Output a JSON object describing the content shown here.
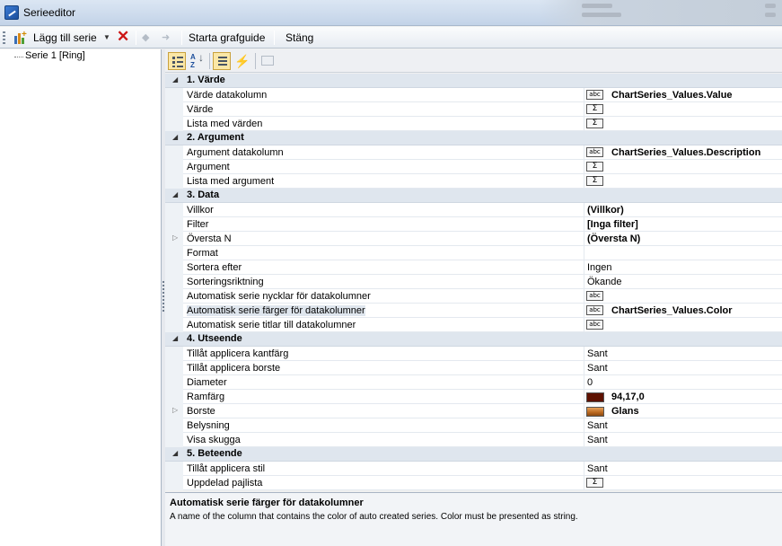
{
  "window": {
    "title": "Serieeditor"
  },
  "toolbar": {
    "add_series": "Lägg till serie",
    "start_wizard": "Starta grafguide",
    "close": "Stäng"
  },
  "tree": {
    "items": [
      "Serie 1 [Ring]"
    ]
  },
  "property_grid": {
    "categories": [
      {
        "label": "1. Värde",
        "rows": [
          {
            "name": "Värde datakolumn",
            "badge": "abc",
            "value": "ChartSeries_Values.Value"
          },
          {
            "name": "Värde",
            "badge": "Σ",
            "value": ""
          },
          {
            "name": "Lista med värden",
            "badge": "Σ",
            "value": ""
          }
        ]
      },
      {
        "label": "2. Argument",
        "rows": [
          {
            "name": "Argument datakolumn",
            "badge": "abc",
            "value": "ChartSeries_Values.Description"
          },
          {
            "name": "Argument",
            "badge": "Σ",
            "value": ""
          },
          {
            "name": "Lista med argument",
            "badge": "Σ",
            "value": ""
          }
        ]
      },
      {
        "label": "3. Data",
        "rows": [
          {
            "name": "Villkor",
            "value": "(Villkor)"
          },
          {
            "name": "Filter",
            "value": "[Inga filter]"
          },
          {
            "name": "Översta N",
            "value": "(Översta N)"
          },
          {
            "name": "Format",
            "value": ""
          },
          {
            "name": "Sortera efter",
            "value": "Ingen"
          },
          {
            "name": "Sorteringsriktning",
            "value": "Ökande"
          },
          {
            "name": "Automatisk serie nycklar för datakolumner",
            "badge": "abc",
            "value": ""
          },
          {
            "name": "Automatisk serie färger för datakolumner",
            "badge": "abc",
            "value": "ChartSeries_Values.Color"
          },
          {
            "name": "Automatisk serie titlar till datakolumner",
            "badge": "abc",
            "value": ""
          }
        ]
      },
      {
        "label": "4. Utseende",
        "rows": [
          {
            "name": "Tillåt applicera kantfärg",
            "value": "Sant"
          },
          {
            "name": "Tillåt applicera borste",
            "value": "Sant"
          },
          {
            "name": "Diameter",
            "value": "0"
          },
          {
            "name": "Ramfärg",
            "value": "94,17,0"
          },
          {
            "name": "Borste",
            "value": "Glans"
          },
          {
            "name": "Belysning",
            "value": "Sant"
          },
          {
            "name": "Visa skugga",
            "value": "Sant"
          }
        ]
      },
      {
        "label": "5. Beteende",
        "rows": [
          {
            "name": "Tillåt applicera stil",
            "value": "Sant"
          },
          {
            "name": "Uppdelad pajlista",
            "badge": "Σ",
            "value": ""
          }
        ]
      }
    ]
  },
  "colors": {
    "ramfarg_swatch": "#5e1100",
    "borste_swatch": "#b8671f"
  },
  "description": {
    "title": "Automatisk serie färger för datakolumner",
    "text": "A name of the column that contains the color of auto created series. Color must be presented as string."
  }
}
